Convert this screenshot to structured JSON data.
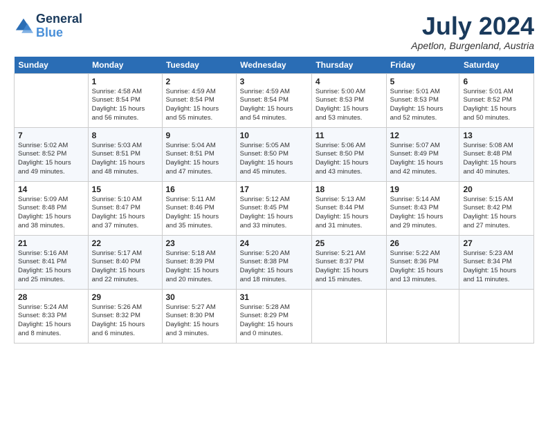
{
  "logo": {
    "line1": "General",
    "line2": "Blue"
  },
  "title": "July 2024",
  "location": "Apetlon, Burgenland, Austria",
  "weekdays": [
    "Sunday",
    "Monday",
    "Tuesday",
    "Wednesday",
    "Thursday",
    "Friday",
    "Saturday"
  ],
  "weeks": [
    [
      {
        "day": "",
        "info": ""
      },
      {
        "day": "1",
        "info": "Sunrise: 4:58 AM\nSunset: 8:54 PM\nDaylight: 15 hours\nand 56 minutes."
      },
      {
        "day": "2",
        "info": "Sunrise: 4:59 AM\nSunset: 8:54 PM\nDaylight: 15 hours\nand 55 minutes."
      },
      {
        "day": "3",
        "info": "Sunrise: 4:59 AM\nSunset: 8:54 PM\nDaylight: 15 hours\nand 54 minutes."
      },
      {
        "day": "4",
        "info": "Sunrise: 5:00 AM\nSunset: 8:53 PM\nDaylight: 15 hours\nand 53 minutes."
      },
      {
        "day": "5",
        "info": "Sunrise: 5:01 AM\nSunset: 8:53 PM\nDaylight: 15 hours\nand 52 minutes."
      },
      {
        "day": "6",
        "info": "Sunrise: 5:01 AM\nSunset: 8:52 PM\nDaylight: 15 hours\nand 50 minutes."
      }
    ],
    [
      {
        "day": "7",
        "info": "Sunrise: 5:02 AM\nSunset: 8:52 PM\nDaylight: 15 hours\nand 49 minutes."
      },
      {
        "day": "8",
        "info": "Sunrise: 5:03 AM\nSunset: 8:51 PM\nDaylight: 15 hours\nand 48 minutes."
      },
      {
        "day": "9",
        "info": "Sunrise: 5:04 AM\nSunset: 8:51 PM\nDaylight: 15 hours\nand 47 minutes."
      },
      {
        "day": "10",
        "info": "Sunrise: 5:05 AM\nSunset: 8:50 PM\nDaylight: 15 hours\nand 45 minutes."
      },
      {
        "day": "11",
        "info": "Sunrise: 5:06 AM\nSunset: 8:50 PM\nDaylight: 15 hours\nand 43 minutes."
      },
      {
        "day": "12",
        "info": "Sunrise: 5:07 AM\nSunset: 8:49 PM\nDaylight: 15 hours\nand 42 minutes."
      },
      {
        "day": "13",
        "info": "Sunrise: 5:08 AM\nSunset: 8:48 PM\nDaylight: 15 hours\nand 40 minutes."
      }
    ],
    [
      {
        "day": "14",
        "info": "Sunrise: 5:09 AM\nSunset: 8:48 PM\nDaylight: 15 hours\nand 38 minutes."
      },
      {
        "day": "15",
        "info": "Sunrise: 5:10 AM\nSunset: 8:47 PM\nDaylight: 15 hours\nand 37 minutes."
      },
      {
        "day": "16",
        "info": "Sunrise: 5:11 AM\nSunset: 8:46 PM\nDaylight: 15 hours\nand 35 minutes."
      },
      {
        "day": "17",
        "info": "Sunrise: 5:12 AM\nSunset: 8:45 PM\nDaylight: 15 hours\nand 33 minutes."
      },
      {
        "day": "18",
        "info": "Sunrise: 5:13 AM\nSunset: 8:44 PM\nDaylight: 15 hours\nand 31 minutes."
      },
      {
        "day": "19",
        "info": "Sunrise: 5:14 AM\nSunset: 8:43 PM\nDaylight: 15 hours\nand 29 minutes."
      },
      {
        "day": "20",
        "info": "Sunrise: 5:15 AM\nSunset: 8:42 PM\nDaylight: 15 hours\nand 27 minutes."
      }
    ],
    [
      {
        "day": "21",
        "info": "Sunrise: 5:16 AM\nSunset: 8:41 PM\nDaylight: 15 hours\nand 25 minutes."
      },
      {
        "day": "22",
        "info": "Sunrise: 5:17 AM\nSunset: 8:40 PM\nDaylight: 15 hours\nand 22 minutes."
      },
      {
        "day": "23",
        "info": "Sunrise: 5:18 AM\nSunset: 8:39 PM\nDaylight: 15 hours\nand 20 minutes."
      },
      {
        "day": "24",
        "info": "Sunrise: 5:20 AM\nSunset: 8:38 PM\nDaylight: 15 hours\nand 18 minutes."
      },
      {
        "day": "25",
        "info": "Sunrise: 5:21 AM\nSunset: 8:37 PM\nDaylight: 15 hours\nand 15 minutes."
      },
      {
        "day": "26",
        "info": "Sunrise: 5:22 AM\nSunset: 8:36 PM\nDaylight: 15 hours\nand 13 minutes."
      },
      {
        "day": "27",
        "info": "Sunrise: 5:23 AM\nSunset: 8:34 PM\nDaylight: 15 hours\nand 11 minutes."
      }
    ],
    [
      {
        "day": "28",
        "info": "Sunrise: 5:24 AM\nSunset: 8:33 PM\nDaylight: 15 hours\nand 8 minutes."
      },
      {
        "day": "29",
        "info": "Sunrise: 5:26 AM\nSunset: 8:32 PM\nDaylight: 15 hours\nand 6 minutes."
      },
      {
        "day": "30",
        "info": "Sunrise: 5:27 AM\nSunset: 8:30 PM\nDaylight: 15 hours\nand 3 minutes."
      },
      {
        "day": "31",
        "info": "Sunrise: 5:28 AM\nSunset: 8:29 PM\nDaylight: 15 hours\nand 0 minutes."
      },
      {
        "day": "",
        "info": ""
      },
      {
        "day": "",
        "info": ""
      },
      {
        "day": "",
        "info": ""
      }
    ]
  ]
}
